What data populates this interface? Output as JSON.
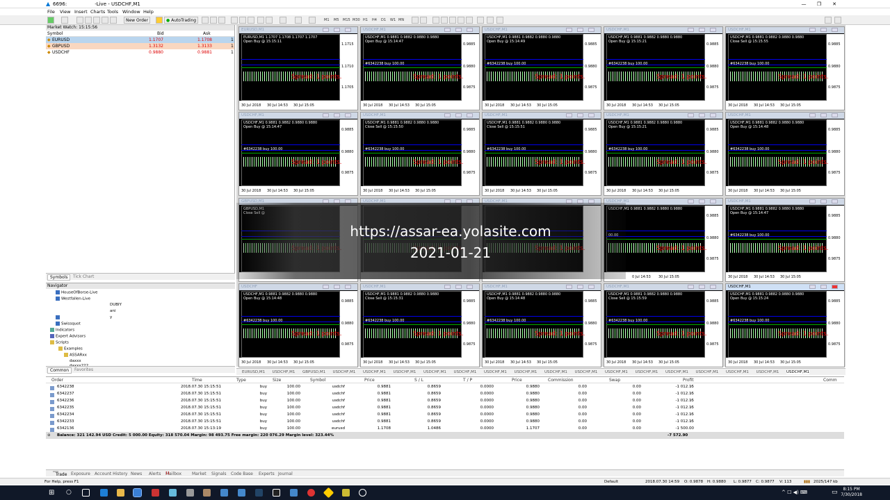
{
  "window": {
    "app_number": "6696:",
    "title": "-Live - USDCHF,M1"
  },
  "menu": [
    "File",
    "View",
    "Insert",
    "Charts",
    "Tools",
    "Window",
    "Help"
  ],
  "toolbar": {
    "new_order": "New Order",
    "autotrading": "AutoTrading",
    "timeframes": [
      "M1",
      "M5",
      "M15",
      "M30",
      "H1",
      "H4",
      "D1",
      "W1",
      "MN"
    ]
  },
  "market_watch": {
    "title": "Market Watch: 15:15:56",
    "columns": [
      "Symbol",
      "Bid",
      "Ask"
    ],
    "rows": [
      {
        "symbol": "EURUSD",
        "bid": "1.1707",
        "ask": "1.1708",
        "extra": "1",
        "bg": "#b9d5ee"
      },
      {
        "symbol": "GBPUSD",
        "bid": "1.3132",
        "ask": "1.3133",
        "extra": "1",
        "bg": "#f9d7c0"
      },
      {
        "symbol": "USDCHF",
        "bid": "0.9880",
        "ask": "0.9881",
        "extra": "1",
        "bg": "#ffffff"
      }
    ],
    "tabs": [
      "Symbols",
      "Tick Chart"
    ]
  },
  "navigator": {
    "title": "Navigator",
    "items": [
      "HouseOfBorse-Live",
      "Westfallen-Live",
      "DUBIY",
      "ani",
      "y",
      "Swissquot",
      "Indicators",
      "Expert Advisors",
      "Scripts",
      "Examples",
      "ASSARxx",
      "daxxx",
      "daxxx222"
    ],
    "tabs": [
      "Common",
      "Favorites"
    ]
  },
  "charts": [
    {
      "title": "EURUSD,M1",
      "info": "EURUSD,M1  1.1707 1.1708 1.1707 1.1707",
      "sub": "Open Buy @ 15:15:11",
      "order": "",
      "prices": [
        "1.1715",
        "1.1710",
        "1.1705"
      ],
      "dates": [
        "30 Jul 2018",
        "30 Jul 14:53",
        "30 Jul 15:05"
      ]
    },
    {
      "title": "USDCHF,M1",
      "info": "USDCHF,M1  0.9881 0.9882 0.9880 0.9880",
      "sub": "Open Buy @ 15:14:47",
      "order": "#6342238 buy 100.00",
      "prices": [
        "0.9885",
        "0.9880",
        "0.9875"
      ],
      "dates": [
        "30 Jul 2018",
        "30 Jul 14:53",
        "30 Jul 15:05"
      ]
    },
    {
      "title": "USDCHF,M1",
      "info": "USDCHF,M1  0.9881 0.9882 0.9880 0.9880",
      "sub": "Open Buy @ 15:14:49",
      "order": "#6342238 buy 100.00",
      "prices": [
        "0.9885",
        "0.9880",
        "0.9875"
      ],
      "dates": [
        "30 Jul 2018",
        "30 Jul 14:53",
        "30 Jul 15:05"
      ]
    },
    {
      "title": "USDCHF,M1",
      "info": "USDCHF,M1  0.9881 0.9882 0.9880 0.9880",
      "sub": "Open Buy @ 15:15:21",
      "order": "#6342238 buy 100.00",
      "prices": [
        "0.9885",
        "0.9880",
        "0.9875"
      ],
      "dates": [
        "30 Jul 2018",
        "30 Jul 14:53",
        "30 Jul 15:05"
      ]
    },
    {
      "title": "USDCHF,M1",
      "info": "USDCHF,M1  0.9881 0.9882 0.9880 0.9880",
      "sub": "Close Sell @ 15:15:55",
      "order": "#6342238 buy 100.00",
      "prices": [
        "0.9885",
        "0.9880",
        "0.9875"
      ],
      "dates": [
        "30 Jul 2018",
        "30 Jul 14:53",
        "30 Jul 15:05"
      ]
    },
    {
      "title": "USDCHF,M1",
      "info": "USDCHF,M1  0.9881 0.9882 0.9880 0.9880",
      "sub": "Open Buy @ 15:14:47",
      "order": "#6342238 buy 100.00",
      "prices": [
        "0.9885",
        "0.9880",
        "0.9875"
      ],
      "dates": [
        "30 Jul 2018",
        "30 Jul 14:53",
        "30 Jul 15:05"
      ]
    },
    {
      "title": "USDCHF,M1",
      "info": "USDCHF,M1  0.9881 0.9882 0.9880 0.9880",
      "sub": "Close Sell @ 15:15:50",
      "order": "#6342238 buy 100.00",
      "prices": [
        "0.9885",
        "0.9880",
        "0.9875"
      ],
      "dates": [
        "30 Jul 2018",
        "30 Jul 14:53",
        "30 Jul 15:05"
      ]
    },
    {
      "title": "USDCHF,M1",
      "info": "USDCHF,M1  0.9881 0.9882 0.9880 0.9880",
      "sub": "Close Sell @ 15:15:51",
      "order": "#6342238 buy 100.00",
      "prices": [
        "0.9885",
        "0.9880",
        "0.9875"
      ],
      "dates": [
        "30 Jul 2018",
        "30 Jul 14:53",
        "30 Jul 15:05"
      ]
    },
    {
      "title": "USDCHF,M1",
      "info": "USDCHF,M1  0.9881 0.9882 0.9880 0.9880",
      "sub": "Open Buy @ 15:15:21",
      "order": "#6342238 buy 100.00",
      "prices": [
        "0.9885",
        "0.9880",
        "0.9875"
      ],
      "dates": [
        "30 Jul 2018",
        "30 Jul 14:53",
        "30 Jul 15:05"
      ]
    },
    {
      "title": "USDCHF,M1",
      "info": "USDCHF,M1  0.9881 0.9882 0.9880 0.9880",
      "sub": "Open Buy @ 15:14:48",
      "order": "#6342238 buy 100.00",
      "prices": [
        "0.9885",
        "0.9880",
        "0.9875"
      ],
      "dates": [
        "30 Jul 2018",
        "30 Jul 14:53",
        "30 Jul 15:05"
      ]
    },
    {
      "title": "GBPUSD,M1",
      "info": "GBPUSD,M1",
      "sub": "Close Sell @",
      "order": "",
      "prices": [
        "",
        "",
        ""
      ],
      "dates": [
        "",
        "",
        ""
      ]
    },
    {
      "title": "USDCHF,M1",
      "info": "",
      "sub": "",
      "order": "",
      "prices": [
        "",
        "",
        ""
      ],
      "dates": [
        "",
        "",
        ""
      ]
    },
    {
      "title": "USDCHF,M1",
      "info": "",
      "sub": "",
      "order": "",
      "prices": [
        "",
        "",
        ""
      ],
      "dates": [
        "",
        "",
        ""
      ]
    },
    {
      "title": "USDCHF,M1",
      "info": "USDCHF,M1  0.9881 0.9882 0.9880 0.9880",
      "sub": "",
      "order": "00.00",
      "prices": [
        "0.9885",
        "0.9880",
        "0.9875"
      ],
      "dates": [
        "",
        "0 Jul 14:53",
        "30 Jul 15:05"
      ]
    },
    {
      "title": "USDCHF,M1",
      "info": "USDCHF,M1  0.9881 0.9882 0.9880 0.9880",
      "sub": "Open Buy @ 15:14:47",
      "order": "#6342238 buy 100.00",
      "prices": [
        "0.9885",
        "0.9880",
        "0.9875"
      ],
      "dates": [
        "30 Jul 2018",
        "30 Jul 14:53",
        "30 Jul 15:05"
      ]
    },
    {
      "title": "USDCHF",
      "info": "USDCHF,M1  0.9881 0.9882 0.9880 0.9880",
      "sub": "Open Buy @ 15:14:48",
      "order": "#6342238 buy 100.00",
      "prices": [
        "0.9885",
        "0.9880",
        "0.9875"
      ],
      "dates": [
        "30 Jul 2018",
        "30 Jul 14:53",
        "30 Jul 15:05"
      ]
    },
    {
      "title": "USDCHF,M1",
      "info": "USDCHF,M1  0.9881 0.9882 0.9880 0.9880",
      "sub": "Close Sell @ 15:15:31",
      "order": "#6342238 buy 100.00",
      "prices": [
        "0.9885",
        "0.9880",
        "0.9875"
      ],
      "dates": [
        "30 Jul 2018",
        "30 Jul 14:53",
        "30 Jul 15:05"
      ]
    },
    {
      "title": "USDCHF,M1",
      "info": "USDCHF,M1  0.9881 0.9882 0.9880 0.9880",
      "sub": "Open Buy @ 15:14:48",
      "order": "#6342238 buy 100.00",
      "prices": [
        "0.9885",
        "0.9880",
        "0.9875"
      ],
      "dates": [
        "30 Jul 2018",
        "30 Jul 14:53",
        "30 Jul 15:05"
      ]
    },
    {
      "title": "USDCHF,M1",
      "info": "USDCHF,M1  0.9881 0.9882 0.9880 0.9880",
      "sub": "Close Sell @ 15:15:59",
      "order": "#6342238 buy 100.00",
      "prices": [
        "0.9885",
        "0.9880",
        "0.9875"
      ],
      "dates": [
        "30 Jul 2018",
        "30 Jul 14:53",
        "30 Jul 15:05"
      ]
    },
    {
      "title": "USDCHF,M1",
      "info": "USDCHF,M1  0.9881 0.9882 0.9880 0.9880",
      "sub": "Open Buy @ 15:15:24",
      "order": "#6342238 buy 100.00",
      "prices": [
        "0.9885",
        "0.9880",
        "0.9875"
      ],
      "dates": [
        "30 Jul 2018",
        "30 Jul 14:53",
        "30 Jul 15:05"
      ]
    }
  ],
  "spread_text": "Spread: 1 points.",
  "watermark": {
    "url": "https://assar-ea.yolasite.com",
    "date": "2021-01-21"
  },
  "chart_tabs": [
    "EURUSD,M1",
    "USDCHF,M1",
    "GBPUSD,M1",
    "USDCHF,M1",
    "USDCHF,M1",
    "USDCHF,M1",
    "USDCHF,M1",
    "USDCHF,M1",
    "USDCHF,M1",
    "USDCHF,M1",
    "USDCHF,M1",
    "USDCHF,M1",
    "USDCHF,M1",
    "USDCHF,M1",
    "USDCHF,M1",
    "USDCHF,M1",
    "USDCHF,M1",
    "USDCHF,M1",
    "USDCHF,M1"
  ],
  "terminal": {
    "columns": [
      "Order",
      "Time",
      "Type",
      "Size",
      "Symbol",
      "Price",
      "S / L",
      "T / P",
      "Price",
      "Commission",
      "Swap",
      "Profit",
      "Comm"
    ],
    "rows": [
      [
        "6342238",
        "2018.07.30 15:15:51",
        "buy",
        "100.00",
        "usdchf",
        "0.9881",
        "0.8659",
        "0.0000",
        "0.9880",
        "0.00",
        "0.00",
        "-1 012.15"
      ],
      [
        "6342237",
        "2018.07.30 15:15:51",
        "buy",
        "100.00",
        "usdchf",
        "0.9881",
        "0.8659",
        "0.0000",
        "0.9880",
        "0.00",
        "0.00",
        "-1 012.15"
      ],
      [
        "6342236",
        "2018.07.30 15:15:51",
        "buy",
        "100.00",
        "usdchf",
        "0.9881",
        "0.8659",
        "0.0000",
        "0.9880",
        "0.00",
        "0.00",
        "-1 012.15"
      ],
      [
        "6342235",
        "2018.07.30 15:15:51",
        "buy",
        "100.00",
        "usdchf",
        "0.9881",
        "0.8659",
        "0.0000",
        "0.9880",
        "0.00",
        "0.00",
        "-1 012.15"
      ],
      [
        "6342234",
        "2018.07.30 15:15:51",
        "buy",
        "100.00",
        "usdchf",
        "0.9881",
        "0.8659",
        "0.0000",
        "0.9880",
        "0.00",
        "0.00",
        "-1 012.15"
      ],
      [
        "6342233",
        "2018.07.30 15:15:51",
        "buy",
        "100.00",
        "usdchf",
        "0.9881",
        "0.8659",
        "0.0000",
        "0.9880",
        "0.00",
        "0.00",
        "-1 012.15"
      ],
      [
        "6342136",
        "2018.07.30 15:13:19",
        "buy",
        "100.00",
        "eurusd",
        "1.1708",
        "1.0486",
        "0.0000",
        "1.1707",
        "0.00",
        "0.00",
        "-1 500.00"
      ]
    ],
    "balance": "Balance: 321 142.94 USD  Credit: 5 000.00  Equity: 318 570.04  Margin: 98 493.75  Free margin: 220 076.29  Margin level: 323.44%",
    "total": "-7 572.90",
    "tabs": [
      "Trade",
      "Exposure",
      "Account History",
      "News",
      "Alerts",
      "Mailbox",
      "Market",
      "Signals",
      "Code Base",
      "Experts",
      "Journal"
    ],
    "mailbox_badge": "11"
  },
  "status": {
    "help": "For Help, press F1",
    "profile": "Default",
    "time": "2018.07.30 14:59",
    "o": "O: 0.9878",
    "h": "H: 0.9880",
    "l": "L: 0.9877",
    "c": "C: 0.9877",
    "v": "V: 113",
    "traffic": "2025/147 kb"
  },
  "tray": {
    "time": "8:15 PM",
    "date": "7/30/2018"
  }
}
